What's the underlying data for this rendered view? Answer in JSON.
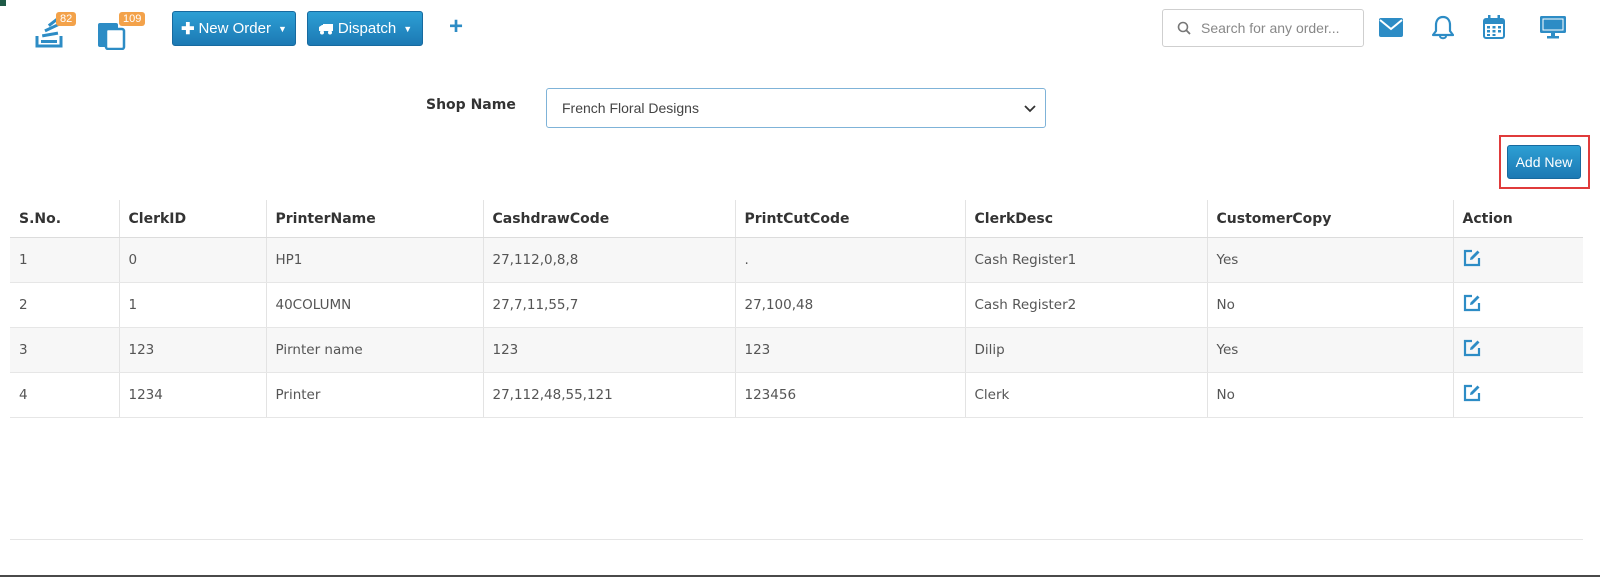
{
  "topbar": {
    "badge_orders": "82",
    "badge_pages": "109",
    "new_order_label": "New Order",
    "dispatch_label": "Dispatch",
    "search_placeholder": "Search for any order...",
    "icons": [
      "stack-icon",
      "documents-icon",
      "plus-icon",
      "mail-icon",
      "bell-icon",
      "calendar-icon",
      "monitor-icon"
    ]
  },
  "shop": {
    "label": "Shop Name",
    "selected": "French Floral Designs"
  },
  "add_new_label": "Add New",
  "table": {
    "headers": [
      "S.No.",
      "ClerkID",
      "PrinterName",
      "CashdrawCode",
      "PrintCutCode",
      "ClerkDesc",
      "CustomerCopy",
      "Action"
    ],
    "rows": [
      [
        "1",
        "0",
        "HP1",
        "27,112,0,8,8",
        ".",
        "Cash Register1",
        "Yes"
      ],
      [
        "2",
        "1",
        "40COLUMN",
        "27,7,11,55,7",
        "27,100,48",
        "Cash Register2",
        "No"
      ],
      [
        "3",
        "123",
        "Pirnter name",
        "123",
        "123",
        "Dilip",
        "Yes"
      ],
      [
        "4",
        "1234",
        "Printer",
        "27,112,48,55,121",
        "123456",
        "Clerk",
        "No"
      ]
    ]
  },
  "colors": {
    "primary": "#1c79b4",
    "badge": "#f3a24a",
    "highlight": "#e03b3b",
    "icon_blue": "#2d8cc5"
  }
}
